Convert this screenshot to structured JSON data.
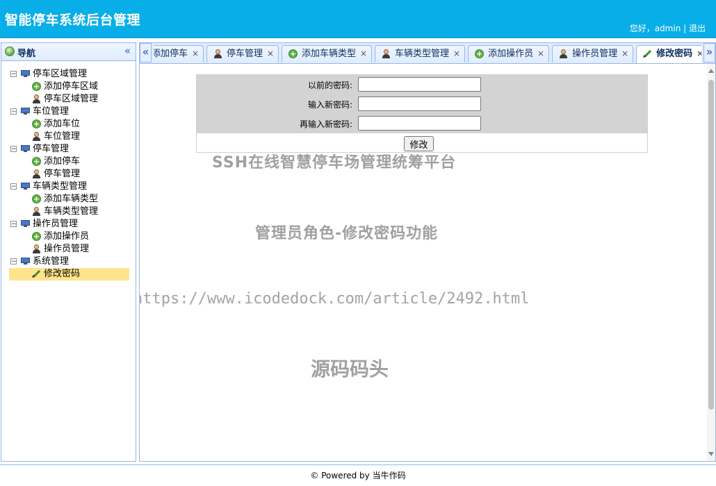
{
  "header": {
    "title": "智能停车系统后台管理",
    "greeting": "您好，admin",
    "separator": " | ",
    "logout": "退出"
  },
  "nav": {
    "title": "导航",
    "groups": [
      {
        "label": "停车区域管理",
        "children": [
          {
            "label": "添加停车区域",
            "icon": "add-icon"
          },
          {
            "label": "停车区域管理",
            "icon": "user-icon"
          }
        ]
      },
      {
        "label": "车位管理",
        "children": [
          {
            "label": "添加车位",
            "icon": "add-icon"
          },
          {
            "label": "车位管理",
            "icon": "user-icon"
          }
        ]
      },
      {
        "label": "停车管理",
        "children": [
          {
            "label": "添加停车",
            "icon": "add-icon"
          },
          {
            "label": "停车管理",
            "icon": "user-icon"
          }
        ]
      },
      {
        "label": "车辆类型管理",
        "children": [
          {
            "label": "添加车辆类型",
            "icon": "add-icon"
          },
          {
            "label": "车辆类型管理",
            "icon": "user-icon"
          }
        ]
      },
      {
        "label": "操作员管理",
        "children": [
          {
            "label": "添加操作员",
            "icon": "add-icon"
          },
          {
            "label": "操作员管理",
            "icon": "user-icon"
          }
        ]
      },
      {
        "label": "系统管理",
        "children": [
          {
            "label": "修改密码",
            "icon": "pencil-icon",
            "selected": true
          }
        ]
      }
    ]
  },
  "tabs": [
    {
      "label": "添加停车",
      "icon": "add-icon"
    },
    {
      "label": "停车管理",
      "icon": "user-icon"
    },
    {
      "label": "添加车辆类型",
      "icon": "add-icon"
    },
    {
      "label": "车辆类型管理",
      "icon": "user-icon"
    },
    {
      "label": "添加操作员",
      "icon": "add-icon"
    },
    {
      "label": "操作员管理",
      "icon": "user-icon"
    },
    {
      "label": "修改密码",
      "icon": "pencil-icon",
      "active": true
    }
  ],
  "tab_close": "×",
  "form": {
    "old_password_label": "以前的密码:",
    "old_password_value": "",
    "new_password_label": "输入新密码:",
    "new_password_value": "",
    "confirm_password_label": "再输入新密码:",
    "confirm_password_value": "",
    "submit_label": "修改"
  },
  "watermarks": {
    "line1": "SSH在线智慧停车场管理统筹平台",
    "line2": "管理员角色-修改密码功能",
    "line3": "https://www.icodedock.com/article/2492.html",
    "line4": "源码码头"
  },
  "footer": {
    "text": "© Powered by 当牛作码"
  },
  "colors": {
    "header_bg": "#08aee7",
    "panel_border": "#95b8e7",
    "selected_bg": "#ffe48d",
    "form_bg": "#d3d3d3"
  }
}
